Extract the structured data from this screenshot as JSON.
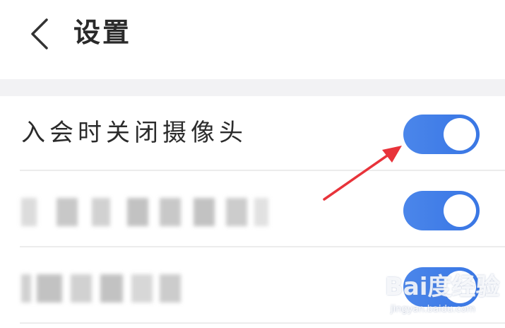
{
  "header": {
    "title": "设置",
    "back_icon": "chevron-left-icon"
  },
  "settings": [
    {
      "label": "入会时关闭摄像头",
      "enabled": true,
      "blurred": false
    },
    {
      "label": "",
      "enabled": true,
      "blurred": true
    },
    {
      "label": "",
      "enabled": true,
      "blurred": true
    }
  ],
  "annotation": {
    "arrow_color": "#e8333a"
  },
  "colors": {
    "toggle_on": "#3f7ce7",
    "section_gap": "#f2f2f4",
    "text": "#2b2b2b"
  },
  "watermark": {
    "logo": "Bai度经验",
    "url": "jingyan.baidu.com"
  }
}
